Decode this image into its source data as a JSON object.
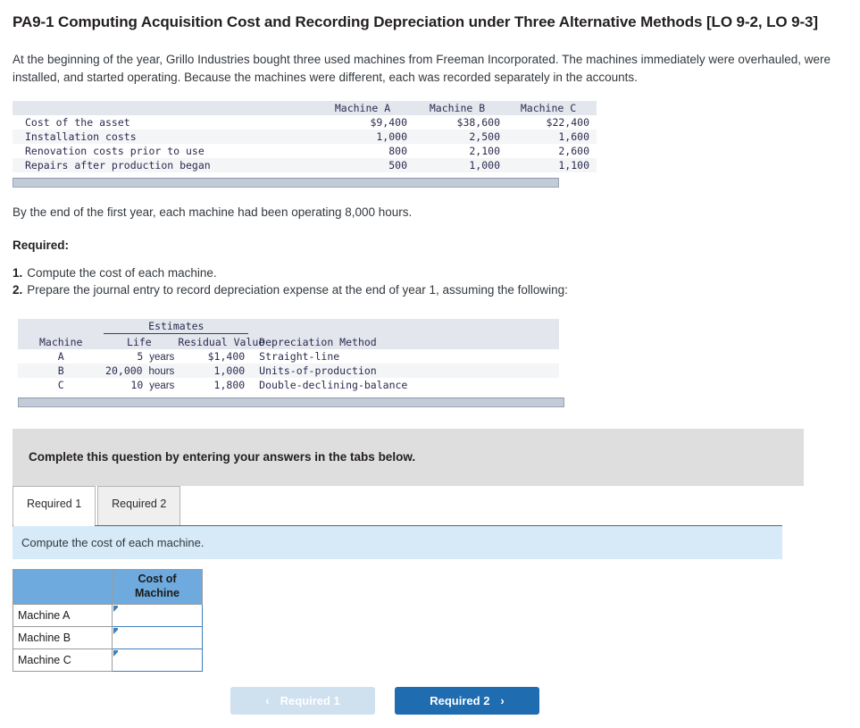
{
  "title": "PA9-1 Computing Acquisition Cost and Recording Depreciation under Three Alternative Methods [LO 9-2, LO 9-3]",
  "intro_paragraph": "At the beginning of the year, Grillo Industries bought three used machines from Freeman Incorporated. The machines immediately were overhauled, were installed, and started operating. Because the machines were different, each was recorded separately in the accounts.",
  "cost_table": {
    "headers": [
      "",
      "Machine A",
      "Machine B",
      "Machine C"
    ],
    "rows": [
      {
        "label": "Cost of the asset",
        "a": "$9,400",
        "b": "$38,600",
        "c": "$22,400"
      },
      {
        "label": "Installation costs",
        "a": "1,000",
        "b": "2,500",
        "c": "1,600"
      },
      {
        "label": "Renovation costs prior to use",
        "a": "800",
        "b": "2,100",
        "c": "2,600"
      },
      {
        "label": "Repairs after production began",
        "a": "500",
        "b": "1,000",
        "c": "1,100"
      }
    ]
  },
  "hours_paragraph": "By the end of the first year, each machine had been operating 8,000 hours.",
  "required_heading": "Required:",
  "required_items": [
    {
      "num": "1.",
      "text": "Compute the cost of each machine."
    },
    {
      "num": "2.",
      "text": "Prepare the journal entry to record depreciation expense at the end of year 1, assuming the following:"
    }
  ],
  "estimates_table": {
    "group_header": "Estimates",
    "headers": [
      "Machine",
      "Life",
      "Residual Value",
      "Depreciation Method"
    ],
    "rows": [
      {
        "machine": "A",
        "life_num": "5",
        "life_unit": "years",
        "residual": "$1,400",
        "method": "Straight-line"
      },
      {
        "machine": "B",
        "life_num": "20,000",
        "life_unit": "hours",
        "residual": "1,000",
        "method": "Units-of-production"
      },
      {
        "machine": "C",
        "life_num": "10",
        "life_unit": "years",
        "residual": "1,800",
        "method": "Double-declining-balance"
      }
    ]
  },
  "instruction_banner": "Complete this question by entering your answers in the tabs below.",
  "tabs": [
    {
      "label": "Required 1",
      "active": true
    },
    {
      "label": "Required 2",
      "active": false
    }
  ],
  "sub_instruction": "Compute the cost of each machine.",
  "answer_grid": {
    "corner_label": "",
    "column_header": "Cost of Machine",
    "column_header_line1": "Cost of",
    "column_header_line2": "Machine",
    "rows": [
      {
        "label": "Machine A",
        "value": ""
      },
      {
        "label": "Machine B",
        "value": ""
      },
      {
        "label": "Machine C",
        "value": ""
      }
    ]
  },
  "nav": {
    "prev_label": "Required 1",
    "next_label": "Required 2",
    "prev_chevron": "‹",
    "next_chevron": "›"
  },
  "colors": {
    "accent_blue": "#1f6cb0",
    "header_blue": "#6eaadd",
    "info_blue": "#d6eaf8",
    "banner_grey": "#dedede",
    "table_header_grey": "#e3e7ed",
    "footbar_grey": "#c4cbd8"
  }
}
